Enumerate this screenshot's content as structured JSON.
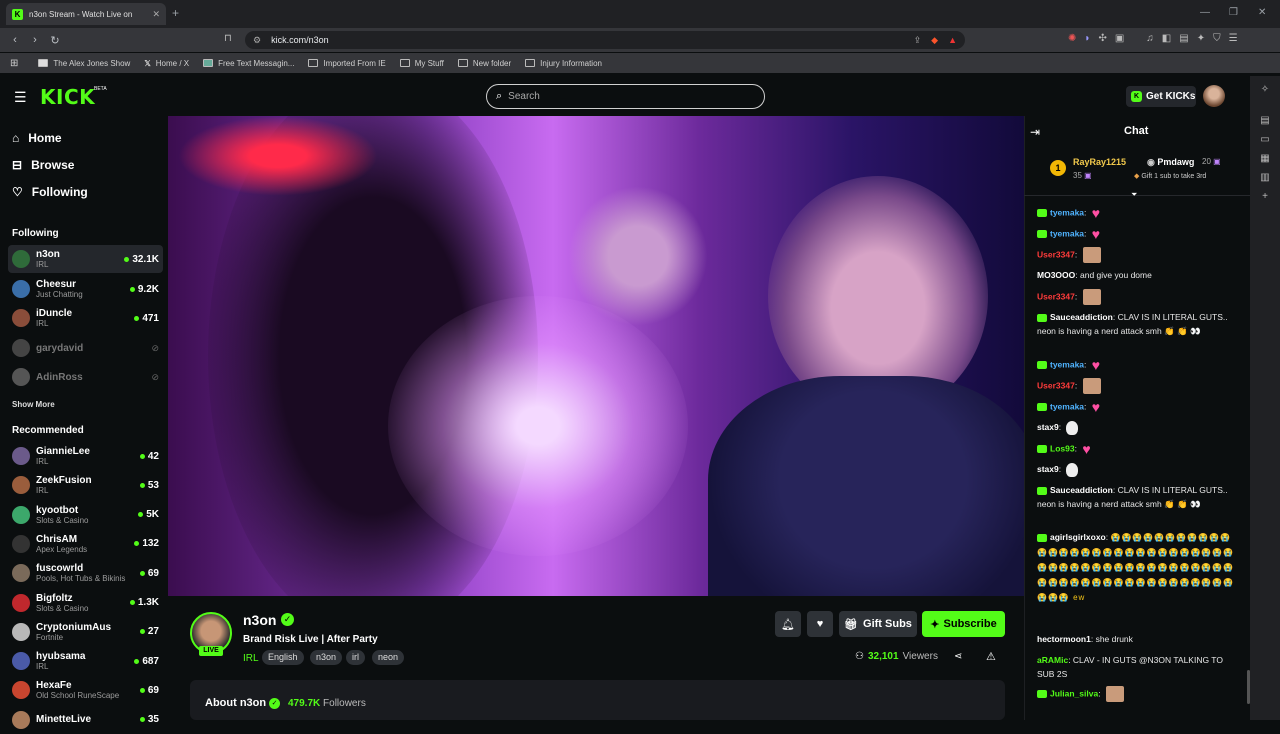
{
  "browser": {
    "tab_title": "n3on Stream - Watch Live on",
    "url": "kick.com/n3on",
    "bookmarks": [
      "The Alex Jones Show",
      "Home / X",
      "Free Text Messagin...",
      "Imported From IE",
      "My Stuff",
      "New folder",
      "Injury Information"
    ]
  },
  "header": {
    "logo": "KICK",
    "beta": "BETA",
    "search_placeholder": "Search",
    "get_kicks": "Get KICKs"
  },
  "sidebar": {
    "nav": [
      "Home",
      "Browse",
      "Following"
    ],
    "following_heading": "Following",
    "following": [
      {
        "name": "n3on",
        "category": "IRL",
        "viewers": "32.1K",
        "live": true,
        "avatar_color": "#2f6b3a"
      },
      {
        "name": "Cheesur",
        "category": "Just Chatting",
        "viewers": "9.2K",
        "live": true,
        "avatar_color": "#3a6ea8"
      },
      {
        "name": "iDuncle",
        "category": "IRL",
        "viewers": "471",
        "live": true,
        "avatar_color": "#8a4d3a"
      },
      {
        "name": "garydavid",
        "category": "",
        "viewers": "",
        "live": false,
        "avatar_color": "#444"
      },
      {
        "name": "AdinRoss",
        "category": "",
        "viewers": "",
        "live": false,
        "avatar_color": "#555"
      }
    ],
    "show_more": "Show More",
    "recommended_heading": "Recommended",
    "recommended": [
      {
        "name": "GiannieLee",
        "category": "IRL",
        "viewers": "42",
        "avatar_color": "#6b5a8a"
      },
      {
        "name": "ZeekFusion",
        "category": "IRL",
        "viewers": "53",
        "avatar_color": "#9a5d3c"
      },
      {
        "name": "kyootbot",
        "category": "Slots & Casino",
        "viewers": "5K",
        "avatar_color": "#3ca86b"
      },
      {
        "name": "ChrisAM",
        "category": "Apex Legends",
        "viewers": "132",
        "avatar_color": "#333"
      },
      {
        "name": "fuscowrld",
        "category": "Pools, Hot Tubs & Bikinis",
        "viewers": "69",
        "avatar_color": "#7a6a5a"
      },
      {
        "name": "Bigfoltz",
        "category": "Slots & Casino",
        "viewers": "1.3K",
        "avatar_color": "#c0282d"
      },
      {
        "name": "CryptoniumAus",
        "category": "Fortnite",
        "viewers": "27",
        "avatar_color": "#b8b8b8"
      },
      {
        "name": "hyubsama",
        "category": "IRL",
        "viewers": "687",
        "avatar_color": "#4a5aa8"
      },
      {
        "name": "HexaFe",
        "category": "Old School RuneScape",
        "viewers": "69",
        "avatar_color": "#c9452f"
      },
      {
        "name": "MinetteLive",
        "category": "",
        "viewers": "35",
        "avatar_color": "#a87a5a"
      }
    ]
  },
  "stream": {
    "channel": "n3on",
    "title": "Brand Risk Live | After Party",
    "category": "IRL",
    "tags": [
      "English",
      "n3on",
      "irl",
      "neon"
    ],
    "live_label": "LIVE",
    "gift_subs": "Gift Subs",
    "subscribe": "Subscribe",
    "viewers": "32,101",
    "viewers_label": "Viewers",
    "about_title": "About n3on",
    "followers": "479.7K",
    "followers_label": "Followers"
  },
  "chat": {
    "title": "Chat",
    "gifter1": {
      "rank": "1",
      "name": "RayRay1215",
      "count": "35"
    },
    "gifter2": {
      "name": "Pmdawg",
      "count": "20"
    },
    "gifter3_note": "Gift 1 sub to take 3rd",
    "messages": [
      {
        "user": "tyemaka",
        "color": "#4fb3ff",
        "badge": true,
        "text": "",
        "emote": "heart"
      },
      {
        "user": "tyemaka",
        "color": "#4fb3ff",
        "badge": true,
        "text": "",
        "emote": "heart"
      },
      {
        "user": "User3347",
        "color": "#ff3b3b",
        "badge": false,
        "text": "",
        "emote": "face"
      },
      {
        "user": "MO3OOO",
        "color": "#ffffff",
        "badge": false,
        "text": "and give you dome",
        "emote": ""
      },
      {
        "user": "User3347",
        "color": "#ff3b3b",
        "badge": false,
        "text": "",
        "emote": "face"
      },
      {
        "user": "Sauceaddiction",
        "color": "#ffffff",
        "badge": true,
        "text": "CLAV IS IN LITERAL GUTS.. neon is having a nerd attack smh 👏 👏 👀",
        "emote": ""
      },
      {
        "user": "tyemaka",
        "color": "#4fb3ff",
        "badge": true,
        "text": "",
        "emote": "heart"
      },
      {
        "user": "User3347",
        "color": "#ff3b3b",
        "badge": false,
        "text": "",
        "emote": "face"
      },
      {
        "user": "tyemaka",
        "color": "#4fb3ff",
        "badge": true,
        "text": "",
        "emote": "heart"
      },
      {
        "user": "stax9",
        "color": "#ffffff",
        "badge": false,
        "text": "",
        "emote": "mask"
      },
      {
        "user": "Los93",
        "color": "#53fc18",
        "badge": true,
        "text": "",
        "emote": "heart"
      },
      {
        "user": "stax9",
        "color": "#ffffff",
        "badge": false,
        "text": "",
        "emote": "mask"
      },
      {
        "user": "Sauceaddiction",
        "color": "#ffffff",
        "badge": true,
        "text": "CLAV IS IN LITERAL GUTS.. neon is having a nerd attack smh 👏 👏 👀",
        "emote": ""
      },
      {
        "user": "agirlsgirlxoxo",
        "color": "#ffffff",
        "badge": true,
        "text": "😭😭😭😭😭😭😭😭😭😭😭😭😭😭😭😭😭😭😭😭😭😭😭😭😭😭😭😭😭😭😭😭😭😭😭😭😭😭😭😭😭😭😭😭😭😭😭😭😭😭😭😭😭😭😭😭😭😭😭😭😭😭😭😭😭😭😭😭 ew",
        "emote": ""
      },
      {
        "user": "hectormoon1",
        "color": "#ffffff",
        "badge": false,
        "text": "she drunk",
        "emote": ""
      },
      {
        "user": "aRAMic",
        "color": "#53fc18",
        "badge": false,
        "text": "CLAV - IN GUTS @N3ON TALKING TO SUB 2S",
        "emote": ""
      },
      {
        "user": "Julian_silva",
        "color": "#53fc18",
        "badge": true,
        "text": "",
        "emote": "face"
      }
    ]
  },
  "colors": {
    "accent": "#53fc18",
    "bg": "#0b0e0f",
    "panel": "#191b1f"
  }
}
